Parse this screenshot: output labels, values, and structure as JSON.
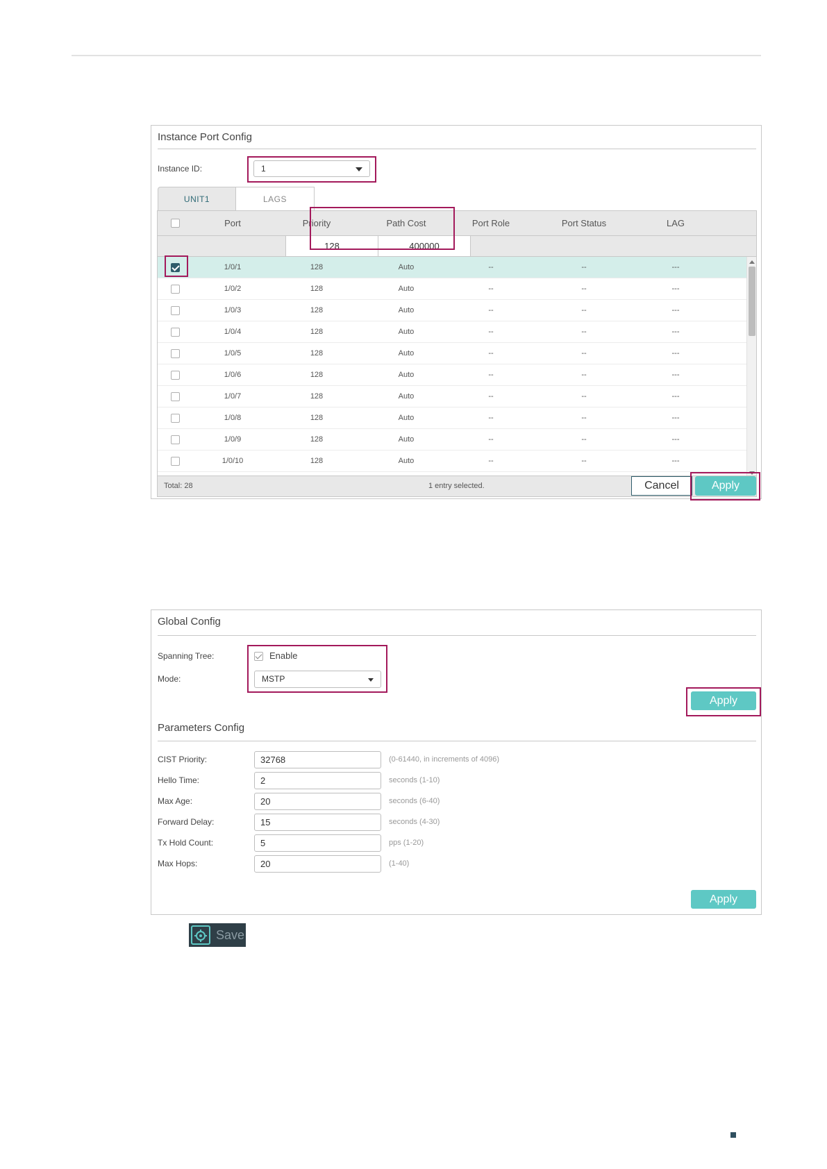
{
  "instance_panel": {
    "title": "Instance Port Config",
    "instance_id_label": "Instance ID:",
    "instance_id_value": "1",
    "tabs": [
      "UNIT1",
      "LAGS"
    ],
    "columns": [
      "Port",
      "Priority",
      "Path Cost",
      "Port Role",
      "Port Status",
      "LAG"
    ],
    "edit_priority": "128",
    "edit_path_cost": "400000",
    "rows": [
      {
        "port": "1/0/1",
        "priority": "128",
        "path_cost": "Auto",
        "role": "--",
        "status": "--",
        "lag": "---"
      },
      {
        "port": "1/0/2",
        "priority": "128",
        "path_cost": "Auto",
        "role": "--",
        "status": "--",
        "lag": "---"
      },
      {
        "port": "1/0/3",
        "priority": "128",
        "path_cost": "Auto",
        "role": "--",
        "status": "--",
        "lag": "---"
      },
      {
        "port": "1/0/4",
        "priority": "128",
        "path_cost": "Auto",
        "role": "--",
        "status": "--",
        "lag": "---"
      },
      {
        "port": "1/0/5",
        "priority": "128",
        "path_cost": "Auto",
        "role": "--",
        "status": "--",
        "lag": "---"
      },
      {
        "port": "1/0/6",
        "priority": "128",
        "path_cost": "Auto",
        "role": "--",
        "status": "--",
        "lag": "---"
      },
      {
        "port": "1/0/7",
        "priority": "128",
        "path_cost": "Auto",
        "role": "--",
        "status": "--",
        "lag": "---"
      },
      {
        "port": "1/0/8",
        "priority": "128",
        "path_cost": "Auto",
        "role": "--",
        "status": "--",
        "lag": "---"
      },
      {
        "port": "1/0/9",
        "priority": "128",
        "path_cost": "Auto",
        "role": "--",
        "status": "--",
        "lag": "---"
      },
      {
        "port": "1/0/10",
        "priority": "128",
        "path_cost": "Auto",
        "role": "--",
        "status": "--",
        "lag": "---"
      }
    ],
    "selected_row": 0,
    "total": "Total: 28",
    "selection_status": "1 entry selected.",
    "cancel_label": "Cancel",
    "apply_label": "Apply"
  },
  "global_panel": {
    "title": "Global Config",
    "spanning_tree_label": "Spanning Tree:",
    "enable_label": "Enable",
    "enabled": true,
    "mode_label": "Mode:",
    "mode_value": "MSTP",
    "apply_label": "Apply"
  },
  "params_panel": {
    "title": "Parameters Config",
    "fields": [
      {
        "label": "CIST Priority:",
        "value": "32768",
        "hint": "(0-61440, in increments of 4096)"
      },
      {
        "label": "Hello Time:",
        "value": "2",
        "hint": "seconds (1-10)"
      },
      {
        "label": "Max Age:",
        "value": "20",
        "hint": "seconds (6-40)"
      },
      {
        "label": "Forward Delay:",
        "value": "15",
        "hint": "seconds (4-30)"
      },
      {
        "label": "Tx Hold Count:",
        "value": "5",
        "hint": "pps (1-20)"
      },
      {
        "label": "Max Hops:",
        "value": "20",
        "hint": "(1-40)"
      }
    ],
    "apply_label": "Apply"
  },
  "save_button": {
    "label": "Save",
    "icon": "gear-icon"
  },
  "colors": {
    "accent": "#5ec8c4",
    "highlight": "#a3195b",
    "selected_row": "#d4eeea",
    "dark": "#2f5d6b"
  }
}
